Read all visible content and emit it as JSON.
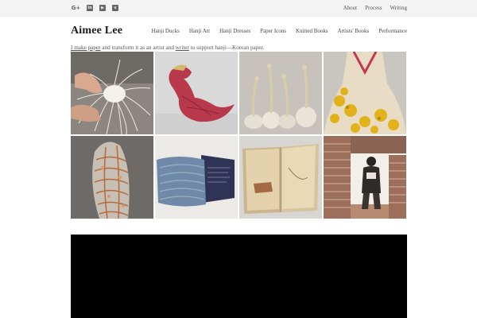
{
  "header": {
    "social_icons": [
      "google-plus-icon",
      "linkedin-icon",
      "youtube-icon",
      "vimeo-icon"
    ],
    "social_glyphs": [
      "G+",
      "in",
      "▶",
      "v"
    ],
    "top_links": [
      "About",
      "Process",
      "Writing"
    ]
  },
  "brand": {
    "name": "Aimee Lee"
  },
  "nav": {
    "items": [
      "Hanji Ducks",
      "Hanji Art",
      "Hanji Dresses",
      "Paper Icons",
      "Knitted Books",
      "Artists' Books",
      "Performance"
    ]
  },
  "intro": {
    "link1": "I make paper",
    "text1": " and transform it as an artist and ",
    "link2": "writer",
    "text2": " to support hanji—Korean paper."
  },
  "gallery": {
    "tiles": [
      "hands-weaving-paper-cord",
      "red-paper-duck",
      "paper-vessels-with-stalks",
      "paper-dress-with-yellow-leaves",
      "woven-paper-sculpture",
      "knitted-blue-book",
      "open-handmade-book",
      "artist-in-brick-installation"
    ]
  },
  "colors": {
    "topbar_bg": "#f3f3f3",
    "video_bg": "#000000"
  }
}
